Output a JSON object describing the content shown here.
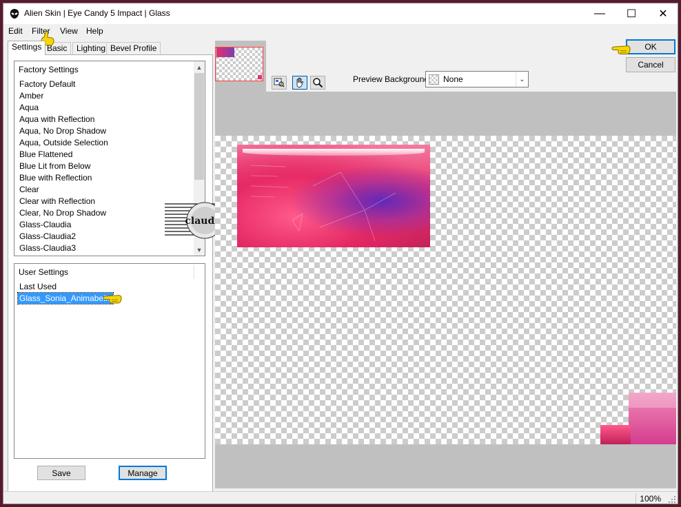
{
  "window": {
    "title": "Alien Skin | Eye Candy 5 Impact | Glass",
    "title_icon": "alien-skin-logo-icon",
    "controls": {
      "minimize": "—",
      "maximize": "☐",
      "close": "✕"
    }
  },
  "menu": [
    {
      "label": "Edit"
    },
    {
      "label": "Filter"
    },
    {
      "label": "View"
    },
    {
      "label": "Help"
    }
  ],
  "tabs": [
    {
      "label": "Settings",
      "active": true
    },
    {
      "label": "Basic",
      "active": false
    },
    {
      "label": "Lighting",
      "active": false
    },
    {
      "label": "Bevel Profile",
      "active": false
    }
  ],
  "factory_settings": {
    "header": "Factory Settings",
    "items": [
      "Factory Default",
      "Amber",
      "Aqua",
      "Aqua with Reflection",
      "Aqua, No Drop Shadow",
      "Aqua, Outside Selection",
      "Blue Flattened",
      "Blue Lit from Below",
      "Blue with Reflection",
      "Clear",
      "Clear with Reflection",
      "Clear, No Drop Shadow",
      "Glass-Claudia",
      "Glass-Claudia2",
      "Glass-Claudia3"
    ]
  },
  "user_settings": {
    "header": "User Settings",
    "items": [
      "Last Used",
      "Glass_Sonia_Animabelle"
    ],
    "selected": "Glass_Sonia_Animabelle"
  },
  "buttons": {
    "save": "Save",
    "manage": "Manage",
    "ok": "OK",
    "cancel": "Cancel"
  },
  "tools": [
    {
      "name": "navigator-icon",
      "pressed": false
    },
    {
      "name": "hand-pan-icon",
      "pressed": true
    },
    {
      "name": "zoom-magnifier-icon",
      "pressed": false
    }
  ],
  "preview_background": {
    "label": "Preview Background:",
    "value": "None"
  },
  "status": {
    "zoom": "100%"
  },
  "watermark": {
    "text": "claudia"
  },
  "colors": {
    "accent": "#0078d7",
    "selection": "#3399ff",
    "pointer_yellow": "#f5d800",
    "art_pink": "#e8306a",
    "art_purple": "#7a3fb0"
  }
}
